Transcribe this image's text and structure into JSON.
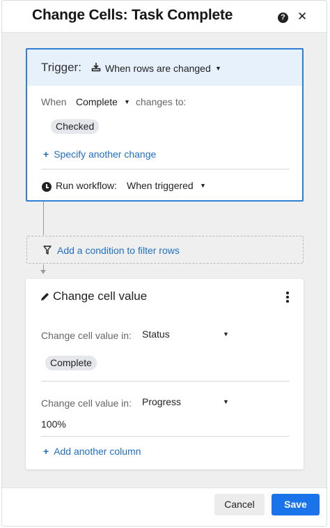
{
  "dialog": {
    "title": "Change Cells: Task Complete",
    "help_icon": "question-circle-icon",
    "close_icon": "close-icon"
  },
  "trigger": {
    "label": "Trigger:",
    "icon": "rows-changed-icon",
    "value": "When rows are changed",
    "when_label": "When",
    "when_column": "Complete",
    "changes_to": "changes to:",
    "chip": "Checked",
    "specify_link": "Specify another change",
    "run_label": "Run workflow:",
    "run_value": "When triggered"
  },
  "condition": {
    "icon": "filter-icon",
    "link": "Add a condition to filter rows"
  },
  "action": {
    "icon": "pencil-icon",
    "title": "Change cell value",
    "rows": [
      {
        "label": "Change cell value in:",
        "column": "Status",
        "value": "Complete"
      },
      {
        "label": "Change cell value in:",
        "column": "Progress",
        "value": "100%"
      }
    ],
    "add_column_link": "Add another column"
  },
  "footer": {
    "cancel_label": "Cancel",
    "save_label": "Save"
  },
  "colors": {
    "accent": "#1a73e8",
    "link": "#1f6fc5",
    "trigger_border": "#2d7fd3",
    "trigger_head_bg": "#e6f1fb"
  }
}
